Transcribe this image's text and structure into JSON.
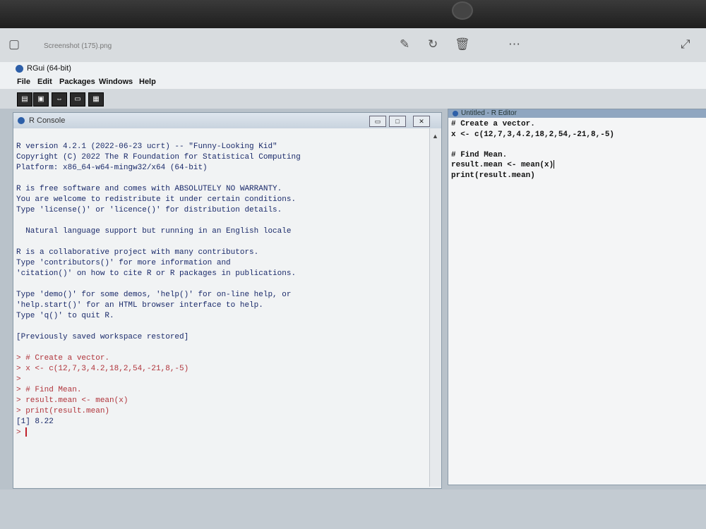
{
  "viewer": {
    "filename": "Screenshot (175).png",
    "icons": [
      "edit-icon",
      "rotate-icon",
      "delete-icon",
      "more-icon",
      "expand-icon"
    ]
  },
  "app": {
    "title": "RGui (64-bit)",
    "menu": [
      "File",
      "Edit",
      "Packages",
      "Windows",
      "Help"
    ],
    "toolbar_buttons": [
      "open-script-icon",
      "load-workspace-icon",
      "save-workspace-icon",
      "copy-icon",
      "paste-icon",
      "print-icon"
    ]
  },
  "console": {
    "title": "R Console",
    "lines": [
      {
        "type": "out",
        "text": ""
      },
      {
        "type": "out",
        "text": "R version 4.2.1 (2022-06-23 ucrt) -- \"Funny-Looking Kid\""
      },
      {
        "type": "out",
        "text": "Copyright (C) 2022 The R Foundation for Statistical Computing"
      },
      {
        "type": "out",
        "text": "Platform: x86_64-w64-mingw32/x64 (64-bit)"
      },
      {
        "type": "out",
        "text": ""
      },
      {
        "type": "out",
        "text": "R is free software and comes with ABSOLUTELY NO WARRANTY."
      },
      {
        "type": "out",
        "text": "You are welcome to redistribute it under certain conditions."
      },
      {
        "type": "out",
        "text": "Type 'license()' or 'licence()' for distribution details."
      },
      {
        "type": "out",
        "text": ""
      },
      {
        "type": "out",
        "text": "  Natural language support but running in an English locale"
      },
      {
        "type": "out",
        "text": ""
      },
      {
        "type": "out",
        "text": "R is a collaborative project with many contributors."
      },
      {
        "type": "out",
        "text": "Type 'contributors()' for more information and"
      },
      {
        "type": "out",
        "text": "'citation()' on how to cite R or R packages in publications."
      },
      {
        "type": "out",
        "text": ""
      },
      {
        "type": "out",
        "text": "Type 'demo()' for some demos, 'help()' for on-line help, or"
      },
      {
        "type": "out",
        "text": "'help.start()' for an HTML browser interface to help."
      },
      {
        "type": "out",
        "text": "Type 'q()' to quit R."
      },
      {
        "type": "out",
        "text": ""
      },
      {
        "type": "out",
        "text": "[Previously saved workspace restored]"
      },
      {
        "type": "out",
        "text": ""
      },
      {
        "type": "cmd",
        "text": "> # Create a vector."
      },
      {
        "type": "cmd",
        "text": "> x <- c(12,7,3,4.2,18,2,54,-21,8,-5)"
      },
      {
        "type": "cmd",
        "text": ">"
      },
      {
        "type": "cmd",
        "text": "> # Find Mean."
      },
      {
        "type": "cmd",
        "text": "> result.mean <- mean(x)"
      },
      {
        "type": "cmd",
        "text": "> print(result.mean)"
      },
      {
        "type": "out",
        "text": "[1] 8.22"
      }
    ],
    "prompt": ">"
  },
  "editor": {
    "title": "Untitled - R Editor",
    "lines": [
      "# Create a vector.",
      "x <- c(12,7,3,4.2,18,2,54,-21,8,-5)",
      "",
      "# Find Mean.",
      "result.mean <- mean(x)",
      "print(result.mean)"
    ]
  },
  "window_buttons": {
    "minimize": "▭",
    "maximize": "□",
    "close": "✕"
  }
}
